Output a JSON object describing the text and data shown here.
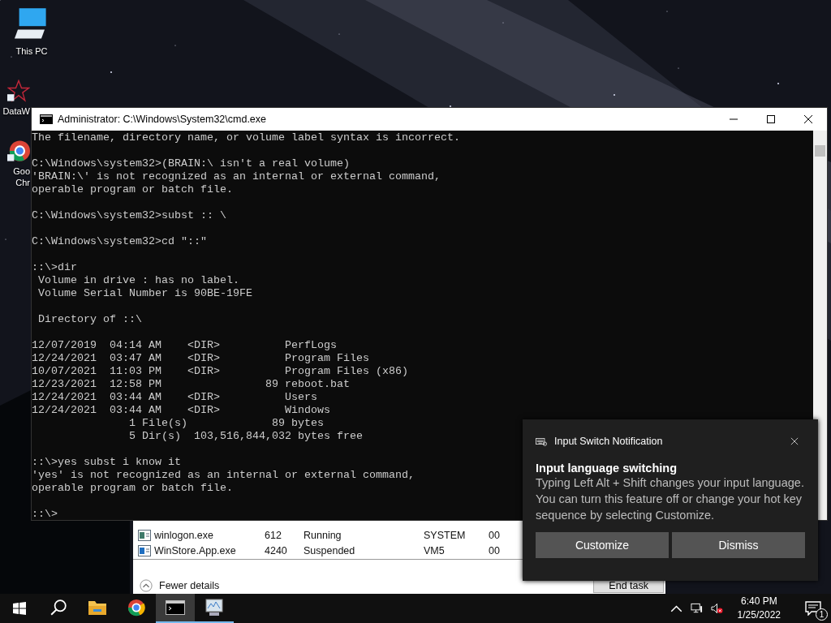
{
  "desktop": {
    "icons": [
      {
        "kind": "pc",
        "label_lines": [
          "This PC"
        ]
      },
      {
        "kind": "app",
        "label_lines": [
          "DataW"
        ]
      },
      {
        "kind": "browser",
        "label_lines": [
          "Goo",
          "Chr"
        ]
      }
    ]
  },
  "task_manager": {
    "rows": [
      {
        "kind": "app",
        "name": "winlogon.exe",
        "pid": "612",
        "status": "Running",
        "user": "SYSTEM",
        "cpu": "00"
      },
      {
        "kind": "store",
        "name": "WinStore.App.exe",
        "pid": "4240",
        "status": "Suspended",
        "user": "VM5",
        "cpu": "00"
      }
    ],
    "fewer_details": "Fewer details",
    "end_task": "End task"
  },
  "cmd_window": {
    "title": "Administrator: C:\\Windows\\System32\\cmd.exe",
    "blocks": [
      [
        "The filename, directory name, or volume label syntax is incorrect."
      ],
      [
        "C:\\Windows\\system32>(BRAIN:\\ isn't a real volume)",
        "'BRAIN:\\' is not recognized as an internal or external command,",
        "operable program or batch file."
      ],
      [
        "C:\\Windows\\system32>subst :: \\"
      ],
      [
        "C:\\Windows\\system32>cd \"::\""
      ],
      [
        "::\\>dir",
        " Volume in drive : has no label.",
        " Volume Serial Number is 90BE-19FE"
      ],
      [
        " Directory of ::\\"
      ],
      [
        "12/07/2019  04:14 AM    <DIR>          PerfLogs",
        "12/24/2021  03:47 AM    <DIR>          Program Files",
        "10/07/2021  11:03 PM    <DIR>          Program Files (x86)",
        "12/23/2021  12:58 PM                89 reboot.bat",
        "12/24/2021  03:44 AM    <DIR>          Users",
        "12/24/2021  03:44 AM    <DIR>          Windows",
        "               1 File(s)             89 bytes",
        "               5 Dir(s)  103,516,844,032 bytes free"
      ],
      [
        "::\\>yes subst i know it",
        "'yes' is not recognized as an internal or external command,",
        "operable program or batch file."
      ],
      [
        "::\\>"
      ]
    ]
  },
  "notification": {
    "app": "Input Switch Notification",
    "title": "Input language switching",
    "body": "Typing Left Alt + Shift changes your input language. You can turn this feature off or change your hot key sequence by selecting Customize.",
    "buttons": [
      "Customize",
      "Dismiss"
    ]
  },
  "taskbar": {
    "items": [
      {
        "kind": "search",
        "running": false,
        "selected": false
      },
      {
        "kind": "folder",
        "running": false,
        "selected": false
      },
      {
        "kind": "browser",
        "running": false,
        "selected": false
      },
      {
        "kind": "console",
        "running": true,
        "selected": true
      },
      {
        "kind": "monitor",
        "running": true,
        "selected": false
      }
    ],
    "time": "6:40 PM",
    "date": "1/25/2022",
    "notification_count": "1"
  }
}
